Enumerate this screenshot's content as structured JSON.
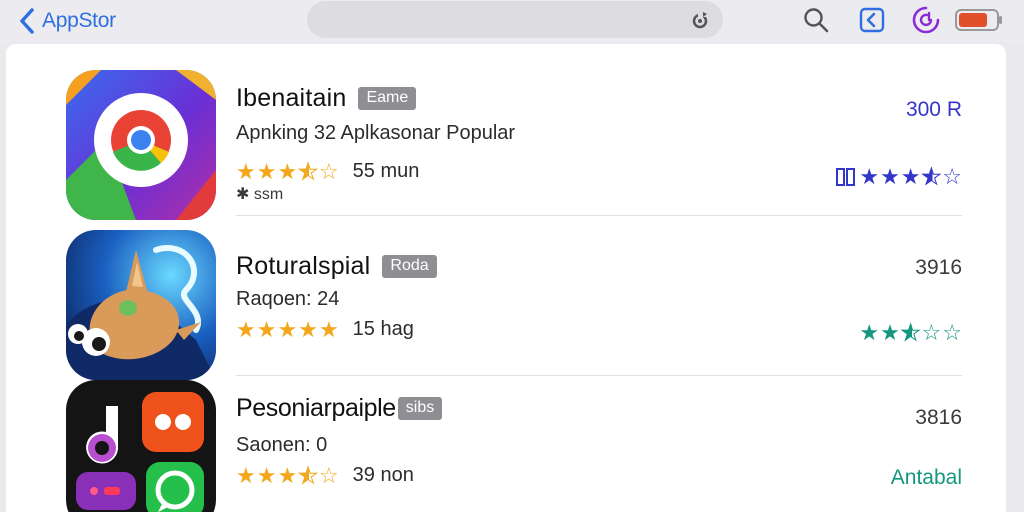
{
  "header": {
    "back_label": "AppStor",
    "search": {
      "placeholder": ""
    },
    "icons": [
      "chevron-left-icon",
      "refresh-icon",
      "search-icon",
      "share-icon",
      "account-icon",
      "battery-icon"
    ],
    "colors": {
      "accent": "#2f6fde",
      "battery": "#e0502a"
    }
  },
  "apps": [
    {
      "name": "Ibenaitain",
      "tag": "Eame",
      "subtitle": "Apnking 32 Aplkasonar Popular",
      "rating_stars": 3.5,
      "rating_label": "55 mun",
      "extra": "ssm",
      "price": "300 R",
      "right_rating_stars": 3.5,
      "right_color": "#3436c9"
    },
    {
      "name": "Roturalspial",
      "tag": "Roda",
      "subtitle": "Raqoen: 24",
      "rating_stars": 5,
      "rating_label": "15 hag",
      "price": "3916",
      "right_rating_stars": 2.5,
      "right_color": "#14977e"
    },
    {
      "name": "Pesoniarpaiple",
      "tag": "sibs",
      "subtitle": "Saonen: 0",
      "rating_stars": 3.5,
      "rating_label": "39 non",
      "price": "3816",
      "right_text": "Antabal",
      "right_color": "#14977e"
    }
  ]
}
